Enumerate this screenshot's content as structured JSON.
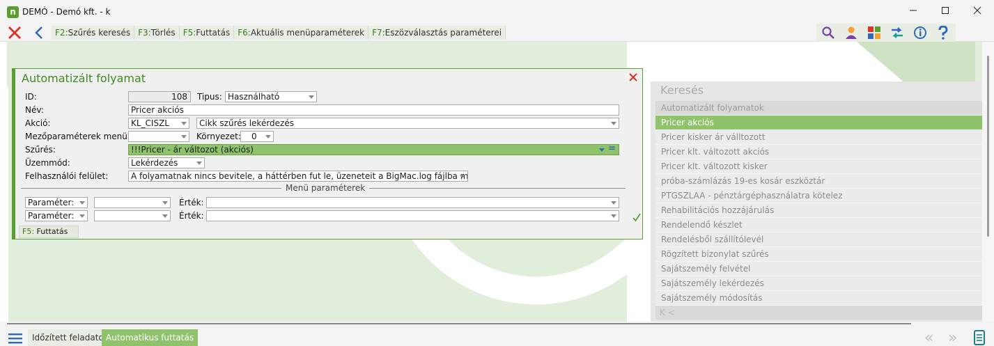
{
  "window": {
    "title": "DEMÓ - Demó kft. - k"
  },
  "toolbar": {
    "fkeys": [
      {
        "key": "F2:",
        "label": "Szűrés keresés"
      },
      {
        "key": "F3:",
        "label": "Törlés"
      },
      {
        "key": "F5:",
        "label": "Futtatás"
      },
      {
        "key": "F6:",
        "label": "Aktuális menüparaméterek"
      },
      {
        "key": "F7:",
        "label": "Eszözválasztás paraméterei"
      }
    ],
    "icons": [
      "search-icon",
      "user-icon",
      "apps-icon",
      "swap-icon",
      "info-icon",
      "help-icon"
    ]
  },
  "dialog": {
    "title": "Automatizált folyamat",
    "id_label": "ID:",
    "id_value": "108",
    "tipus_label": "Tipus:",
    "tipus_value": "Használható",
    "nev_label": "Név:",
    "nev_value": "Pricer akciós",
    "akcio_label": "Akció:",
    "akcio_code": "KL_CISZL",
    "akcio_desc": "Cikk szűrés lekérdezés",
    "mezo_label": "Mezőparaméterek menü:",
    "mezo_value": "",
    "kornyezet_label": "Környezet:",
    "kornyezet_value": "0",
    "szures_label": "Szűrés:",
    "szures_value": "!!!Pricer - ár változot (akciós)",
    "uzemmod_label": "Üzemmód:",
    "uzemmod_value": "Lekérdezés",
    "felulet_label": "Felhasználói felület:",
    "felulet_value": "A folyamatnak nincs bevitele, a háttérben fut le, üzeneteit a BigMac.log fájlba menti",
    "menu_section": "Menü paraméterek",
    "params": [
      {
        "param": "Paraméter:",
        "select": "",
        "ertek_label": "Érték:",
        "ertek": ""
      },
      {
        "param": "Paraméter:",
        "select": "",
        "ertek_label": "Érték:",
        "ertek": ""
      }
    ],
    "run_key": "F5:",
    "run_label": "Futtatás"
  },
  "search_panel": {
    "title": "Keresés",
    "header": "Automatizált folyamatok",
    "items": [
      "Pricer akciós",
      "Pricer kisker ár válltozott",
      "Pricer klt. változott akciós",
      "Pricer klt. változott kisker",
      "próba-számlázás 19-es kosár eszköztár",
      "PTGSZLAA - pénztárgéphasználatra kötelez",
      "Rehabilitációs hozzájárulás",
      "Rendelendő készlet",
      "Rendelésből szállítólevél",
      "Rögzített bizonylat szűrés",
      "Sajátszemély felvétel",
      "Sajátszemély lekérdezés",
      "Sajátszemély módosítás"
    ],
    "selected_index": 0,
    "footer": "K  <"
  },
  "bottom": {
    "tabs": [
      "Időzített feladatok",
      "Automatikus futtatás"
    ],
    "active_tab": 1,
    "nav_prev": "«",
    "nav_next": "»"
  },
  "colors": {
    "accent": "#5aa031",
    "selected": "#8fc36b",
    "close": "#d9352b",
    "link": "#2f6ab8"
  }
}
